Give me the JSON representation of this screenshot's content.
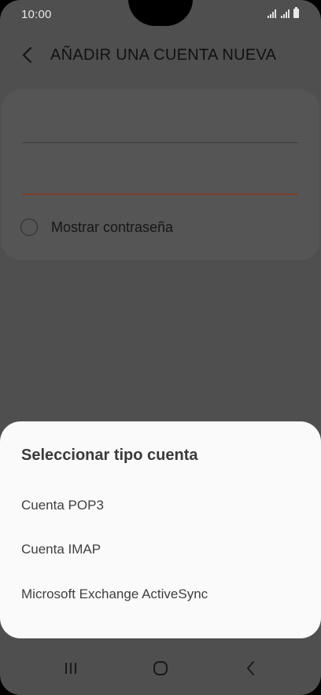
{
  "status_bar": {
    "time": "10:00"
  },
  "app_bar": {
    "title": "AÑADIR UNA CUENTA NUEVA",
    "back_icon": "chevron-left-icon"
  },
  "form": {
    "show_password_label": "Mostrar contraseña",
    "show_password_checked": false
  },
  "sheet": {
    "title": "Seleccionar tipo cuenta",
    "options": [
      "Cuenta POP3",
      "Cuenta IMAP",
      "Microsoft Exchange ActiveSync"
    ]
  },
  "nav_bar": {
    "icons": [
      "recents-icon",
      "home-icon",
      "back-icon"
    ]
  },
  "colors": {
    "scrim": "#4f4f4f",
    "sheet_background": "#fafafa",
    "focus_underline": "#7a3e2b"
  }
}
